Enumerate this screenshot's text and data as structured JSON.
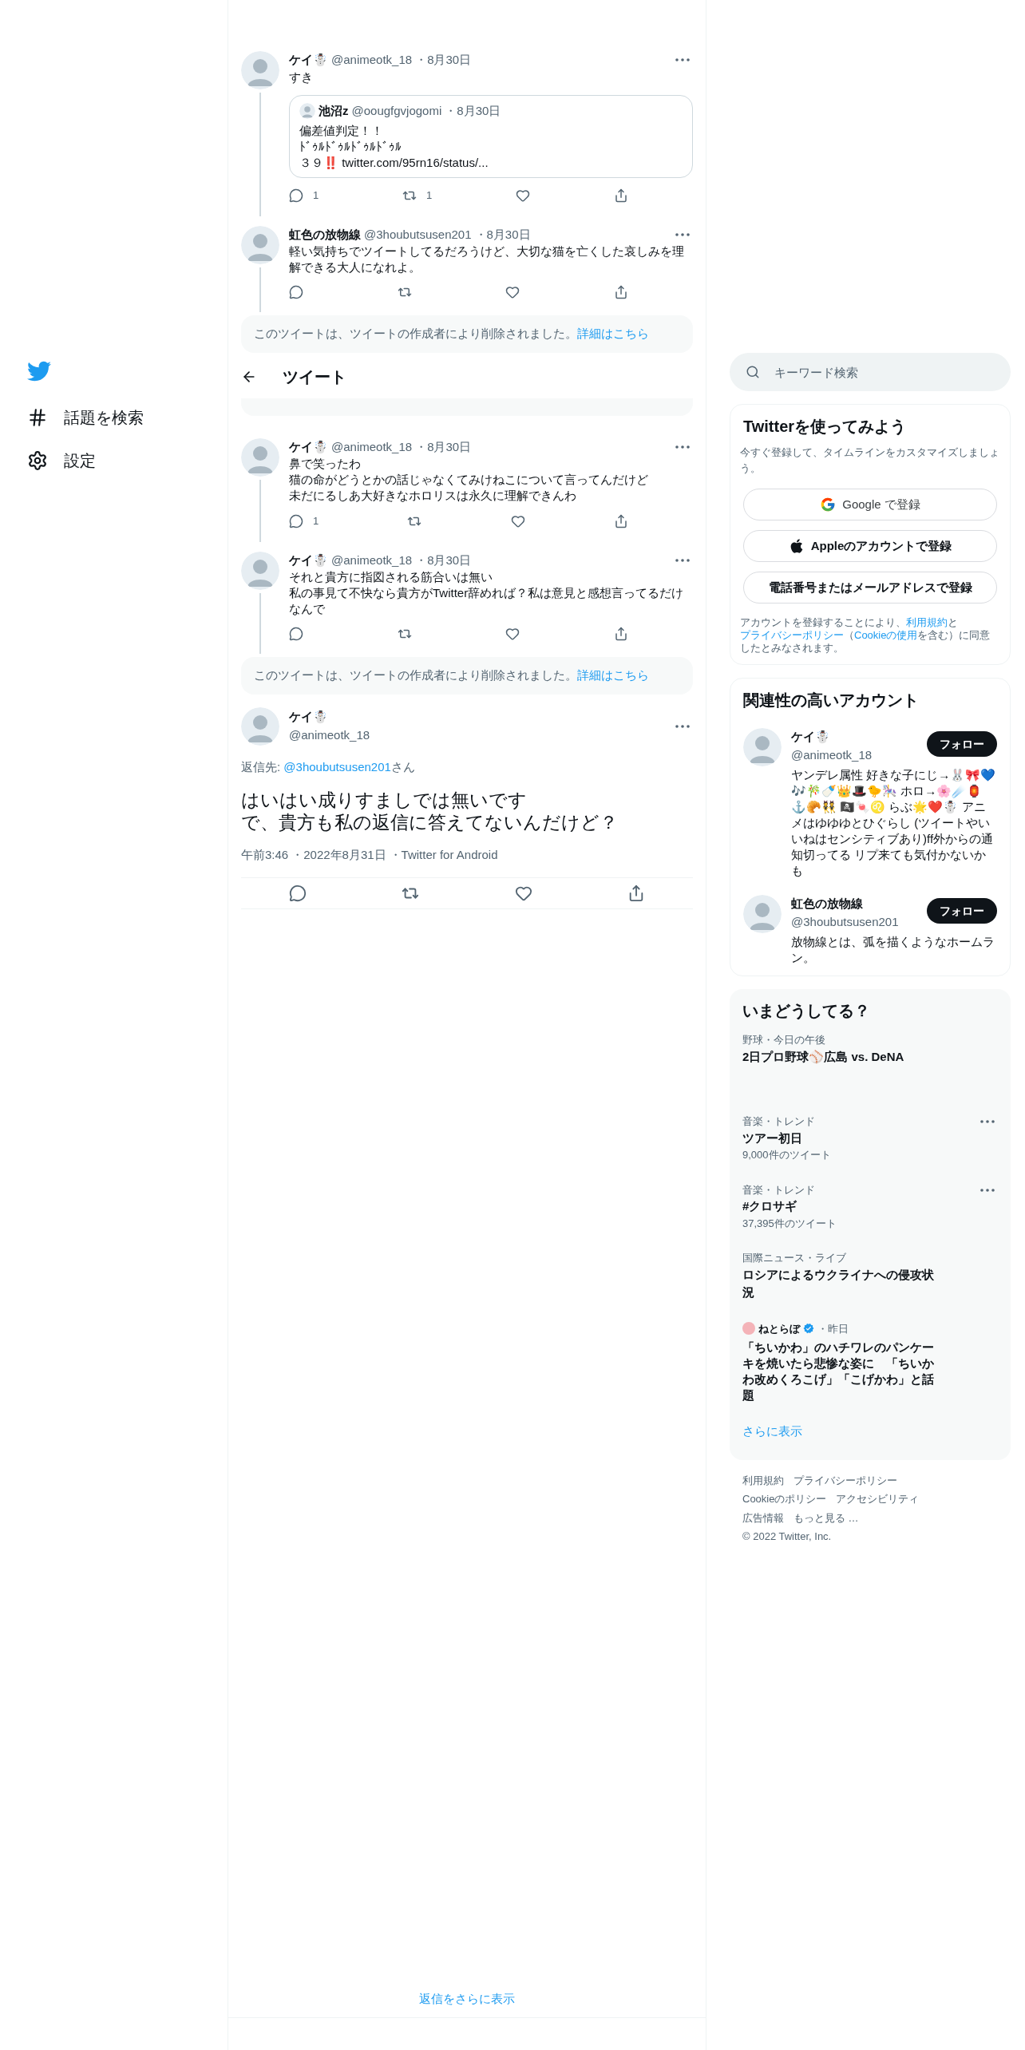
{
  "nav": {
    "items": [
      {
        "label": "話題を検索",
        "kind": "explore"
      },
      {
        "label": "設定",
        "kind": "settings"
      }
    ]
  },
  "thread": [
    {
      "kind": "tweet",
      "name": "ケイ☃️",
      "handle": "@animeotk_18",
      "date": "・8月30日",
      "lines": [
        "すき"
      ],
      "quote": {
        "name": "池沼z",
        "handle": "@oougfgvjogomi",
        "date": "・8月30日",
        "lines": [
          "偏差値判定！！",
          "ﾄﾞｩﾙﾄﾞｩﾙﾄﾞｩﾙﾄﾞｩﾙ",
          "３９‼️ twitter.com/95rn16/status/..."
        ]
      },
      "replies": "1",
      "retweets": "1"
    },
    {
      "kind": "tweet",
      "name": "虹色の放物線",
      "handle": "@3houbutsusen201",
      "date": "・8月30日",
      "lines": [
        "軽い気持ちでツイートしてるだろうけど、大切な猫を亡くした哀しみを理解できる大人になれよ。"
      ]
    },
    {
      "kind": "deleted",
      "text": "このツイートは、ツイートの作成者により削除されました。",
      "link": "詳細はこちら"
    },
    {
      "kind": "header",
      "title": "ツイート"
    },
    {
      "kind": "cut_notice"
    },
    {
      "kind": "tweet",
      "name": "ケイ☃️",
      "handle": "@animeotk_18",
      "date": "・8月30日",
      "lines": [
        "鼻で笑ったわ",
        "猫の命がどうとかの話じゃなくてみけねこについて言ってんだけど",
        "未だにるしあ大好きなホロリスは永久に理解できんわ"
      ],
      "replies": "1"
    },
    {
      "kind": "tweet",
      "name": "ケイ☃️",
      "handle": "@animeotk_18",
      "date": "・8月30日",
      "lines": [
        "それと貴方に指図される筋合いは無い",
        "私の事見て不快なら貴方がTwitter辞めれば？私は意見と感想言ってるだけなんで"
      ]
    },
    {
      "kind": "deleted",
      "text": "このツイートは、ツイートの作成者により削除されました。",
      "link": "詳細はこちら"
    }
  ],
  "main_tweet": {
    "name": "ケイ☃️",
    "handle": "@animeotk_18",
    "reply_label": "返信先:",
    "reply_handle": "@3houbutsusen201",
    "reply_suffix": "さん",
    "lines": [
      "はいはい成りすましでは無いです",
      "で、貴方も私の返信に答えてないんだけど？"
    ],
    "meta": [
      "午前3:46",
      "・2022年8月31日",
      "・Twitter for Android"
    ]
  },
  "show_more_replies": "返信をさらに表示",
  "search": {
    "placeholder": "キーワード検索"
  },
  "signup": {
    "title": "Twitterを使ってみよう",
    "subtitle": "今すぐ登録して、タイムラインをカスタマイズしましょう。",
    "buttons": [
      {
        "kind": "google",
        "label": "Google で登録"
      },
      {
        "kind": "apple",
        "label": "Appleのアカウントで登録"
      },
      {
        "kind": "phone",
        "label": "電話番号またはメールアドレスで登録"
      }
    ],
    "legal": [
      {
        "text": "アカウントを登録することにより、",
        "link": false
      },
      {
        "text": "利用規約",
        "link": true
      },
      {
        "text": "と",
        "link": false
      },
      {
        "text": "プライバシーポリシー",
        "link": true
      },
      {
        "text": "（",
        "link": false
      },
      {
        "text": "Cookieの使用",
        "link": true
      },
      {
        "text": "を含む）に同意したとみなされます。",
        "link": false
      }
    ]
  },
  "related": {
    "title": "関連性の高いアカウント",
    "accounts": [
      {
        "name": "ケイ☃️",
        "handle": "@animeotk_18",
        "follow": "フォロー",
        "bio": "ヤンデレ属性 好きな子にじ→🐰🎀💙🎶🎋🍼👑🎩🐤🎠 ホロ→🌸☄️🏮⚓🥐👯 🏴‍☠️🍬♌ らぶ🌟❤️☃️ アニメはゆゆゆとひぐらし (ツイートやいいねはセンシティブあり)ff外からの通知切ってる リプ来ても気付かないかも"
      },
      {
        "name": "虹色の放物線",
        "handle": "@3houbutsusen201",
        "follow": "フォロー",
        "bio": "放物線とは、弧を描くようなホームラン。"
      }
    ]
  },
  "trends": {
    "title": "いまどうしてる？",
    "items": [
      {
        "kind": "trend",
        "category": "野球・今日の午後",
        "title": "2日プロ野球⚾広島 vs. DeNA",
        "menu": false
      },
      {
        "kind": "trend",
        "category": "音楽・トレンド",
        "title": "ツアー初日",
        "count": "9,000件のツイート",
        "menu": true
      },
      {
        "kind": "trend",
        "category": "音楽・トレンド",
        "title": "#クロサギ",
        "count": "37,395件のツイート",
        "menu": true
      },
      {
        "kind": "trend",
        "category": "国際ニュース・ライブ",
        "title": "ロシアによるウクライナへの侵攻状況",
        "menu": false
      },
      {
        "kind": "news",
        "source": "ねとらぼ",
        "verified": true,
        "date": "・昨日",
        "title": "「ちいかわ」のハチワレのパンケーキを焼いたら悲惨な姿に　「ちいかわ改めくろこげ」「こげかわ」と話題"
      }
    ],
    "more": "さらに表示"
  },
  "footer": [
    "利用規約",
    "プライバシーポリシー",
    "Cookieのポリシー",
    "アクセシビリティ",
    "広告情報",
    "もっと見る …",
    "© 2022 Twitter, Inc."
  ]
}
